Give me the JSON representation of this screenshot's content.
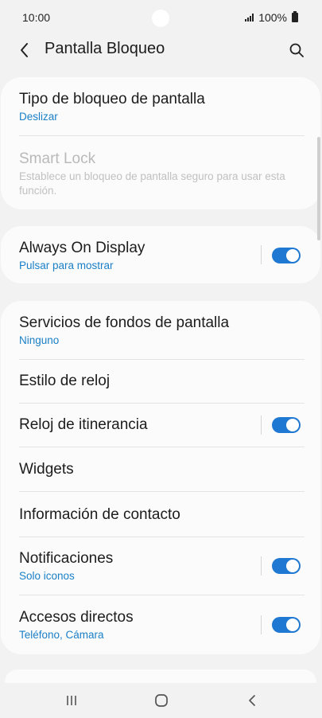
{
  "status_bar": {
    "time": "10:00",
    "battery_text": "100%",
    "signal_icon": "signal-icon",
    "battery_icon": "battery-icon"
  },
  "app_bar": {
    "title": "Pantalla Bloqueo",
    "back_icon": "chevron-left-icon",
    "search_icon": "search-icon"
  },
  "section1": {
    "lock_type": {
      "title": "Tipo de bloqueo de pantalla",
      "value": "Deslizar"
    },
    "smart_lock": {
      "title": "Smart Lock",
      "description": "Establece un bloqueo de pantalla seguro para usar esta función."
    }
  },
  "section2": {
    "always_on": {
      "title": "Always On Display",
      "value": "Pulsar para mostrar",
      "enabled": true
    }
  },
  "section3": {
    "wallpaper_services": {
      "title": "Servicios de fondos de pantalla",
      "value": "Ninguno"
    },
    "clock_style": {
      "title": "Estilo de reloj"
    },
    "roaming_clock": {
      "title": "Reloj de itinerancia",
      "enabled": true
    },
    "widgets": {
      "title": "Widgets"
    },
    "contact_info": {
      "title": "Información de contacto"
    },
    "notifications": {
      "title": "Notificaciones",
      "value": "Solo iconos",
      "enabled": true
    },
    "shortcuts": {
      "title": "Accesos directos",
      "value": "Teléfono, Cámara",
      "enabled": true
    }
  },
  "nav_bar": {
    "recents_icon": "recents-icon",
    "home_icon": "home-icon",
    "back_icon": "back-icon"
  },
  "colors": {
    "accent": "#1f78d1",
    "link_text": "#1a7fc6",
    "background": "#f2f2f2",
    "card": "#fbfbfb"
  }
}
